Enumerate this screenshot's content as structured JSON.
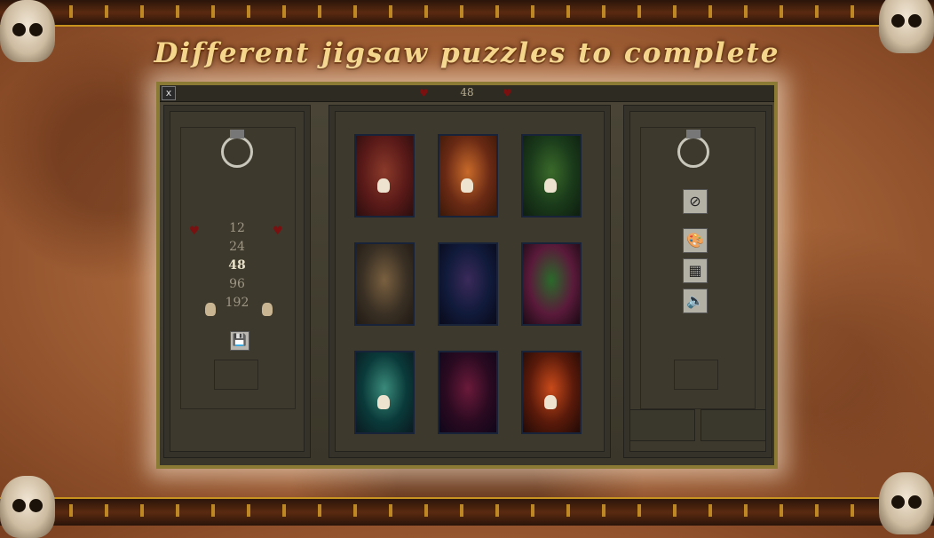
{
  "headline": "Different jigsaw puzzles to complete",
  "board": {
    "close_label": "x",
    "piece_count": "48"
  },
  "sizes": {
    "options": [
      "12",
      "24",
      "48",
      "96",
      "192"
    ],
    "selected": "48"
  },
  "icons": {
    "close": "close-icon",
    "save": "floppy-disk-icon",
    "no_background": "circle-slash-icon",
    "palette": "palette-icon",
    "image": "image-icon",
    "sound": "speaker-icon"
  },
  "tool_glyphs": {
    "save": "💾",
    "no_background": "⊘",
    "palette": "🎨",
    "image": "▦",
    "sound": "🔈"
  },
  "puzzles": [
    {
      "colors": [
        "#5a1a18",
        "#8a3a2a",
        "#2a0e0e"
      ]
    },
    {
      "colors": [
        "#6a2a14",
        "#c86a2a",
        "#3a1808"
      ]
    },
    {
      "colors": [
        "#1a3a1a",
        "#3a6a2a",
        "#0e1e10"
      ]
    },
    {
      "colors": [
        "#3a3024",
        "#7a6040",
        "#201a14"
      ]
    },
    {
      "colors": [
        "#101a3a",
        "#3a2a5a",
        "#0a0a1a"
      ]
    },
    {
      "colors": [
        "#5a1a3a",
        "#2a6a2a",
        "#1a0a14"
      ]
    },
    {
      "colors": [
        "#0a3a3a",
        "#3a8a7a",
        "#0a1a20"
      ]
    },
    {
      "colors": [
        "#2a0a20",
        "#6a1a3a",
        "#10061a"
      ]
    },
    {
      "colors": [
        "#5a1a0a",
        "#c84a1a",
        "#200a06"
      ]
    }
  ]
}
